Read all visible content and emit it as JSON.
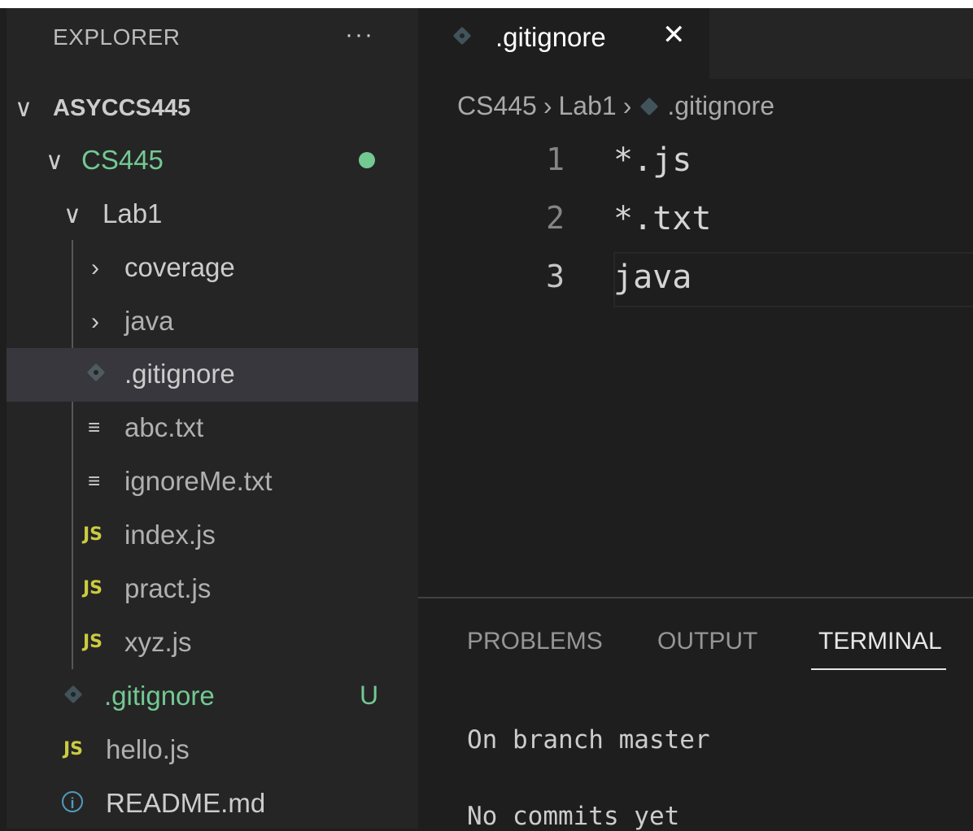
{
  "explorer": {
    "title": "EXPLORER",
    "more_label": "···",
    "workspace": "ASYCCS445",
    "tree": [
      {
        "label": "CS445",
        "kind": "folder",
        "expanded": true,
        "status": "dot"
      },
      {
        "label": "Lab1",
        "kind": "folder",
        "expanded": true
      },
      {
        "label": "coverage",
        "kind": "folder",
        "expanded": false
      },
      {
        "label": "java",
        "kind": "folder",
        "expanded": false
      },
      {
        "label": ".gitignore",
        "kind": "git-file",
        "selected": true
      },
      {
        "label": "abc.txt",
        "kind": "text-file"
      },
      {
        "label": "ignoreMe.txt",
        "kind": "text-file"
      },
      {
        "label": "index.js",
        "kind": "js-file"
      },
      {
        "label": "pract.js",
        "kind": "js-file"
      },
      {
        "label": "xyz.js",
        "kind": "js-file"
      },
      {
        "label": ".gitignore",
        "kind": "git-file",
        "badge": "U"
      },
      {
        "label": "hello.js",
        "kind": "js-file"
      },
      {
        "label": "README.md",
        "kind": "info-file"
      }
    ],
    "js_icon": "JS"
  },
  "editor": {
    "tab": {
      "label": ".gitignore",
      "close": "✕"
    },
    "breadcrumb": [
      "CS445",
      "Lab1",
      ".gitignore"
    ],
    "breadcrumb_sep": "›",
    "lines": [
      {
        "num": "1",
        "text": "*.js"
      },
      {
        "num": "2",
        "text": "*.txt"
      },
      {
        "num": "3",
        "text": "java"
      }
    ]
  },
  "panel": {
    "tabs": [
      "PROBLEMS",
      "OUTPUT",
      "TERMINAL"
    ],
    "active_tab": "TERMINAL",
    "terminal_lines": [
      "On branch master",
      "No commits yet"
    ]
  },
  "colors": {
    "git_added": "#73c991",
    "js_icon": "#cbcb41",
    "info_icon": "#519aba"
  }
}
